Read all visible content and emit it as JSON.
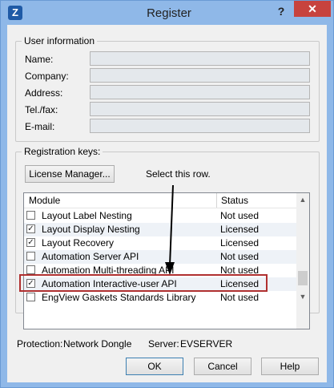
{
  "window": {
    "title": "Register",
    "help_glyph": "?",
    "close_glyph": "✕",
    "app_icon_letter": "Z"
  },
  "user_info": {
    "legend": "User information",
    "fields": [
      {
        "label": "Name:",
        "value": ""
      },
      {
        "label": "Company:",
        "value": ""
      },
      {
        "label": "Address:",
        "value": ""
      },
      {
        "label": "Tel./fax:",
        "value": ""
      },
      {
        "label": "E-mail:",
        "value": ""
      }
    ]
  },
  "registration": {
    "legend": "Registration keys:",
    "license_manager_label": "License Manager...",
    "annotation": "Select this row.",
    "columns": {
      "module": "Module",
      "status": "Status"
    },
    "rows": [
      {
        "module": "Layout Label Nesting",
        "status": "Not used",
        "checked": false
      },
      {
        "module": "Layout Display Nesting",
        "status": "Licensed",
        "checked": true
      },
      {
        "module": "Layout Recovery",
        "status": "Licensed",
        "checked": true
      },
      {
        "module": "Automation Server API",
        "status": "Not used",
        "checked": false
      },
      {
        "module": "Automation Multi-threading API",
        "status": "Not used",
        "checked": false
      },
      {
        "module": "Automation Interactive-user API",
        "status": "Licensed",
        "checked": true
      },
      {
        "module": "EngView Gaskets Standards Library",
        "status": "Not used",
        "checked": false
      }
    ]
  },
  "footer": {
    "protection_label": "Protection:",
    "protection_value": "Network Dongle",
    "server_label": "Server:",
    "server_value": "EVSERVER"
  },
  "buttons": {
    "ok": "OK",
    "cancel": "Cancel",
    "help": "Help"
  },
  "colors": {
    "title_bar": "#8fb8e8",
    "close": "#c7433e",
    "highlight": "#b03030"
  }
}
